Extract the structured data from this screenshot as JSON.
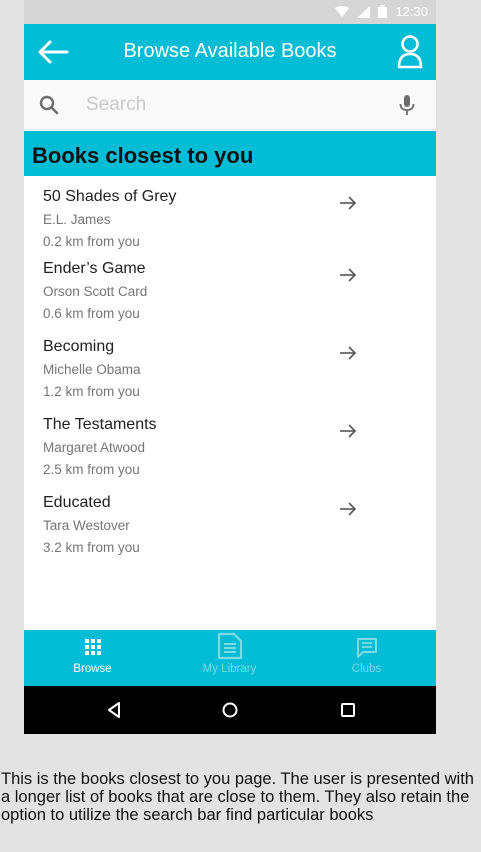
{
  "status_bar": {
    "time": "12:30"
  },
  "app_bar": {
    "title": "Browse Available Books",
    "back_icon": "arrow-left-icon",
    "profile_icon": "person-outline-icon"
  },
  "search": {
    "placeholder": "Search",
    "value": ""
  },
  "section": {
    "title": "Books closest to you"
  },
  "books": [
    {
      "title": "50 Shades of Grey",
      "author": "E.L. James",
      "distance": "0.2 km from you"
    },
    {
      "title": "Ender’s Game",
      "author": "Orson Scott Card",
      "distance": "0.6 km from you"
    },
    {
      "title": "Becoming",
      "author": "Michelle Obama",
      "distance": "1.2 km from you"
    },
    {
      "title": "The Testaments",
      "author": "Margaret Atwood",
      "distance": "2.5 km from you"
    },
    {
      "title": "Educated",
      "author": "Tara Westover",
      "distance": "3.2 km from you"
    }
  ],
  "bottom_nav": {
    "items": [
      {
        "label": "Browse",
        "active": true,
        "icon": "grid-icon"
      },
      {
        "label": "My Library",
        "active": false,
        "icon": "document-icon"
      },
      {
        "label": "Clubs",
        "active": false,
        "icon": "chat-icon"
      }
    ]
  },
  "colors": {
    "primary": "#00bcd4",
    "inactive_nav": "#7fd9e6"
  },
  "caption": "This is the books closest to you page. The user is presented with a longer list of books that are close to them. They also retain the option to utilize the search bar find particular books"
}
